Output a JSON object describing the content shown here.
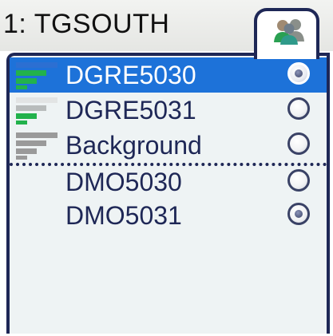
{
  "header": {
    "title": "1: TGSOUTH",
    "tab_icon": "users-group-icon"
  },
  "list": {
    "items": [
      {
        "label": "DGRE5030",
        "selected": true,
        "radio_on": true,
        "indicator": "green-bars"
      },
      {
        "label": "DGRE5031",
        "selected": false,
        "radio_on": false,
        "indicator": "green-bars"
      },
      {
        "label": "Background",
        "selected": false,
        "radio_on": false,
        "indicator": "gray-bars"
      },
      {
        "label": "DMO5030",
        "selected": false,
        "radio_on": false,
        "indicator": "none"
      },
      {
        "label": "DMO5031",
        "selected": false,
        "radio_on": true,
        "indicator": "none"
      }
    ]
  },
  "colors": {
    "selection": "#1d72d9",
    "border": "#1e2756",
    "text": "#1e2756",
    "signal_green": "#22b24c",
    "signal_gray": "#9a9a9a"
  }
}
